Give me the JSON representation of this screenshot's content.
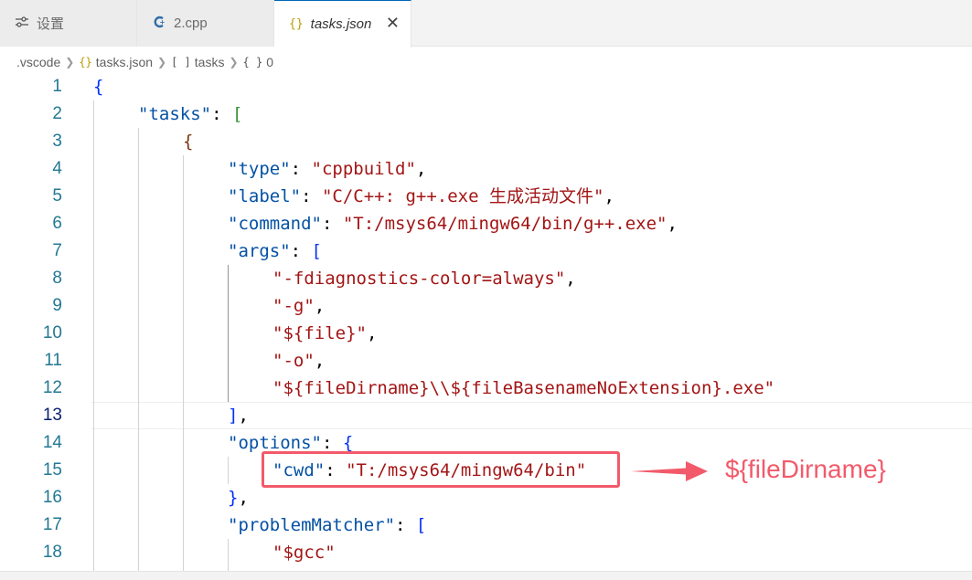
{
  "tabs": [
    {
      "label": "设置",
      "icon": "settings-icon"
    },
    {
      "label": "2.cpp",
      "icon": "cpp-file-icon"
    },
    {
      "label": "tasks.json",
      "icon": "json-file-icon",
      "active": true
    }
  ],
  "tab_close_glyph": "✕",
  "breadcrumb": {
    "folder": ".vscode",
    "file": "tasks.json",
    "array_label": "tasks",
    "object_label": "0",
    "array_icon": "[ ]",
    "object_icon": "{ }",
    "file_icon": "{}"
  },
  "lines": {
    "l1": {
      "num": "1",
      "t1": "{"
    },
    "l2": {
      "num": "2",
      "t1": "\"tasks\"",
      "t2": ": ",
      "t3": "["
    },
    "l3": {
      "num": "3",
      "t1": "{"
    },
    "l4": {
      "num": "4",
      "t1": "\"type\"",
      "t2": ": ",
      "t3": "\"cppbuild\"",
      "t4": ","
    },
    "l5": {
      "num": "5",
      "t1": "\"label\"",
      "t2": ": ",
      "t3": "\"C/C++: g++.exe 生成活动文件\"",
      "t4": ","
    },
    "l6": {
      "num": "6",
      "t1": "\"command\"",
      "t2": ": ",
      "t3": "\"T:/msys64/mingw64/bin/g++.exe\"",
      "t4": ","
    },
    "l7": {
      "num": "7",
      "t1": "\"args\"",
      "t2": ": ",
      "t3": "["
    },
    "l8": {
      "num": "8",
      "t1": "\"-fdiagnostics-color=always\"",
      "t2": ","
    },
    "l9": {
      "num": "9",
      "t1": "\"-g\"",
      "t2": ","
    },
    "l10": {
      "num": "10",
      "t1": "\"${file}\"",
      "t2": ","
    },
    "l11": {
      "num": "11",
      "t1": "\"-o\"",
      "t2": ","
    },
    "l12": {
      "num": "12",
      "t1": "\"${fileDirname}\\\\${fileBasenameNoExtension}.exe\""
    },
    "l13": {
      "num": "13",
      "t1": "]",
      "t2": ","
    },
    "l14": {
      "num": "14",
      "t1": "\"options\"",
      "t2": ": ",
      "t3": "{"
    },
    "l15": {
      "num": "15",
      "t1": "\"cwd\"",
      "t2": ": ",
      "t3": "\"T:/msys64/mingw64/bin\""
    },
    "l16": {
      "num": "16",
      "t1": "}",
      "t2": ","
    },
    "l17": {
      "num": "17",
      "t1": "\"problemMatcher\"",
      "t2": ": ",
      "t3": "["
    },
    "l18": {
      "num": "18",
      "t1": "\"$gcc\""
    }
  },
  "annotation": {
    "text": "${fileDirname}",
    "color": "#f25a6b"
  },
  "colors": {
    "key": "#0451a5",
    "string": "#a31515",
    "bracket_level1": "#0431fa",
    "bracket_level2": "#319331",
    "bracket_level3": "#7b3814",
    "line_number": "#237893",
    "active_tab_border": "#0066b8"
  }
}
